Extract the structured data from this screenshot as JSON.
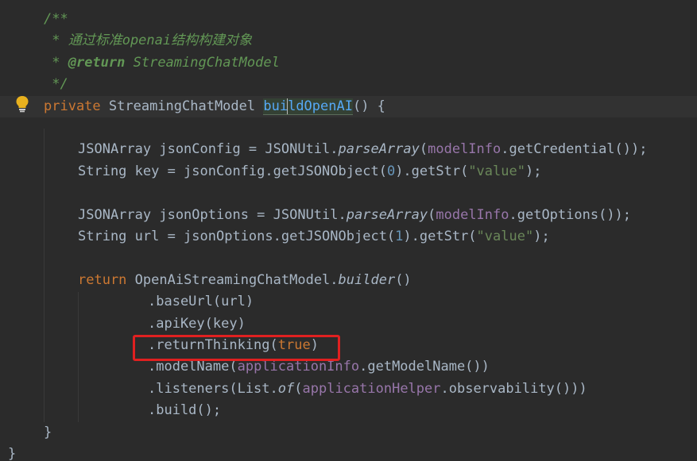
{
  "editor": {
    "lines": [
      {
        "id": "l1",
        "segments": [
          {
            "t": "/**",
            "c": "cm"
          }
        ]
      },
      {
        "id": "l2",
        "segments": [
          {
            "t": " * 通过标准openai结构构建对象",
            "c": "cm"
          }
        ]
      },
      {
        "id": "l3",
        "segments": [
          {
            "t": " * ",
            "c": "cm"
          },
          {
            "t": "@return",
            "c": "cm-tag"
          },
          {
            "t": " StreamingChatModel",
            "c": "cm"
          }
        ]
      },
      {
        "id": "l4",
        "segments": [
          {
            "t": " */",
            "c": "cm"
          }
        ]
      },
      {
        "id": "l5",
        "segments": [
          {
            "t": "private ",
            "c": "kw"
          },
          {
            "t": "StreamingChatModel ",
            "c": "ty"
          },
          {
            "t": "bui",
            "c": "hl-method"
          },
          {
            "t": "|caret|",
            "c": "caret"
          },
          {
            "t": "ldOpenAI",
            "c": "hl-method"
          },
          {
            "t": "() {",
            "c": "punc"
          }
        ]
      },
      {
        "id": "l6",
        "segments": []
      },
      {
        "id": "l7",
        "segments": [
          {
            "t": "JSONArray jsonConfig = JSONUtil.",
            "c": "ty"
          },
          {
            "t": "parseArray",
            "c": "stat"
          },
          {
            "t": "(",
            "c": "punc"
          },
          {
            "t": "modelInfo",
            "c": "fld"
          },
          {
            "t": ".getCredential());",
            "c": "punc"
          }
        ]
      },
      {
        "id": "l8",
        "segments": [
          {
            "t": "String key = jsonConfig.getJSONObject(",
            "c": "ty"
          },
          {
            "t": "0",
            "c": "num"
          },
          {
            "t": ").getStr(",
            "c": "punc"
          },
          {
            "t": "\"value\"",
            "c": "str"
          },
          {
            "t": ");",
            "c": "punc"
          }
        ]
      },
      {
        "id": "l9",
        "segments": []
      },
      {
        "id": "l10",
        "segments": [
          {
            "t": "JSONArray jsonOptions = JSONUtil.",
            "c": "ty"
          },
          {
            "t": "parseArray",
            "c": "stat"
          },
          {
            "t": "(",
            "c": "punc"
          },
          {
            "t": "modelInfo",
            "c": "fld"
          },
          {
            "t": ".getOptions());",
            "c": "punc"
          }
        ]
      },
      {
        "id": "l11",
        "segments": [
          {
            "t": "String url = jsonOptions.getJSONObject(",
            "c": "ty"
          },
          {
            "t": "1",
            "c": "num"
          },
          {
            "t": ").getStr(",
            "c": "punc"
          },
          {
            "t": "\"value\"",
            "c": "str"
          },
          {
            "t": ");",
            "c": "punc"
          }
        ]
      },
      {
        "id": "l12",
        "segments": []
      },
      {
        "id": "l13",
        "segments": [
          {
            "t": "return ",
            "c": "kw"
          },
          {
            "t": "OpenAiStreamingChatModel.",
            "c": "ty"
          },
          {
            "t": "builder",
            "c": "stat"
          },
          {
            "t": "()",
            "c": "punc"
          }
        ]
      },
      {
        "id": "l14",
        "segments": [
          {
            "t": ".baseUrl(url)",
            "c": "ty"
          }
        ]
      },
      {
        "id": "l15",
        "segments": [
          {
            "t": ".apiKey(key)",
            "c": "ty"
          }
        ]
      },
      {
        "id": "l16",
        "segments": [
          {
            "t": ".returnThinking(",
            "c": "ty"
          },
          {
            "t": "true",
            "c": "kw"
          },
          {
            "t": ")",
            "c": "punc"
          }
        ]
      },
      {
        "id": "l17",
        "segments": [
          {
            "t": ".modelName(",
            "c": "ty"
          },
          {
            "t": "applicationInfo",
            "c": "fld"
          },
          {
            "t": ".getModelName())",
            "c": "punc"
          }
        ]
      },
      {
        "id": "l18",
        "segments": [
          {
            "t": ".listeners(List.",
            "c": "ty"
          },
          {
            "t": "of",
            "c": "stat"
          },
          {
            "t": "(",
            "c": "punc"
          },
          {
            "t": "applicationHelper",
            "c": "fld"
          },
          {
            "t": ".observability()))",
            "c": "punc"
          }
        ]
      },
      {
        "id": "l19",
        "segments": [
          {
            "t": ".build();",
            "c": "ty"
          }
        ]
      },
      {
        "id": "l20",
        "segments": [
          {
            "t": "}",
            "c": "punc"
          }
        ]
      },
      {
        "id": "l21",
        "segments": [
          {
            "t": "}",
            "c": "punc"
          }
        ]
      }
    ],
    "colors": {
      "background": "#2b2b2b",
      "comment": "#629755",
      "keyword": "#cc7832",
      "field": "#9876aa",
      "number": "#6897bb",
      "string": "#6a8759",
      "highlight_box": "#e02020"
    },
    "gutter_icon": "lightbulb-icon",
    "annotation": "red-highlight-box"
  }
}
